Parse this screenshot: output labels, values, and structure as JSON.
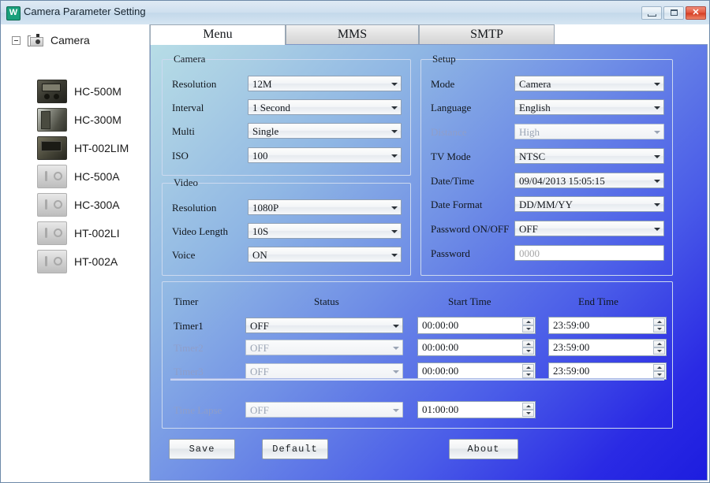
{
  "window": {
    "title": "Camera Parameter Setting",
    "icon": "app-icon",
    "minimize_label": "Minimize",
    "maximize_label": "Maximize",
    "close_label": "Close"
  },
  "sidebar": {
    "root": {
      "label": "Camera",
      "expander": "collapse-minus-icon",
      "icon": "camera-icon"
    },
    "items": [
      {
        "label": "HC-500M",
        "icon": "camera-thumb-icon"
      },
      {
        "label": "HC-300M",
        "icon": "camera-thumb-icon"
      },
      {
        "label": "HT-002LIM",
        "icon": "camera-thumb-icon"
      },
      {
        "label": "HC-500A",
        "icon": "camera-placeholder-icon"
      },
      {
        "label": "HC-300A",
        "icon": "camera-placeholder-icon"
      },
      {
        "label": "HT-002LI",
        "icon": "camera-placeholder-icon"
      },
      {
        "label": "HT-002A",
        "icon": "camera-placeholder-icon"
      }
    ]
  },
  "tabs": [
    {
      "label": "Menu",
      "active": true
    },
    {
      "label": "MMS",
      "active": false
    },
    {
      "label": "SMTP",
      "active": false
    }
  ],
  "camera_group": {
    "title": "Camera",
    "fields": [
      {
        "label": "Resolution",
        "value": "12M",
        "disabled": false
      },
      {
        "label": "Interval",
        "value": "1  Second",
        "disabled": false
      },
      {
        "label": "Multi",
        "value": "Single",
        "disabled": false
      },
      {
        "label": "ISO",
        "value": "100",
        "disabled": false
      }
    ]
  },
  "video_group": {
    "title": "Video",
    "fields": [
      {
        "label": "Resolution",
        "value": "1080P",
        "disabled": false
      },
      {
        "label": "Video Length",
        "value": "10S",
        "disabled": false
      },
      {
        "label": "Voice",
        "value": "ON",
        "disabled": false
      }
    ]
  },
  "setup_group": {
    "title": "Setup",
    "fields": [
      {
        "label": "Mode",
        "value": "Camera",
        "disabled": false,
        "type": "combo"
      },
      {
        "label": "Language",
        "value": "English",
        "disabled": false,
        "type": "combo"
      },
      {
        "label": "Distance",
        "value": "High",
        "disabled": true,
        "type": "combo"
      },
      {
        "label": "TV Mode",
        "value": "NTSC",
        "disabled": false,
        "type": "combo"
      },
      {
        "label": "Date/Time",
        "value": "09/04/2013 15:05:15",
        "disabled": false,
        "type": "combo"
      },
      {
        "label": "Date Format",
        "value": "DD/MM/YY",
        "disabled": false,
        "type": "combo"
      },
      {
        "label": "Password ON/OFF",
        "value": "OFF",
        "disabled": false,
        "type": "combo"
      },
      {
        "label": "Password",
        "value": "0000",
        "disabled": true,
        "type": "text"
      }
    ]
  },
  "timer_group": {
    "columns": {
      "timer": "Timer",
      "status": "Status",
      "start_time": "Start Time",
      "end_time": "End Time"
    },
    "rows": [
      {
        "label": "Timer1",
        "status": "OFF",
        "start_time": "00:00:00",
        "end_time": "23:59:00",
        "disabled": false
      },
      {
        "label": "Timer2",
        "status": "OFF",
        "start_time": "00:00:00",
        "end_time": "23:59:00",
        "disabled": true
      },
      {
        "label": "Timer3",
        "status": "OFF",
        "start_time": "00:00:00",
        "end_time": "23:59:00",
        "disabled": true
      }
    ],
    "time_lapse": {
      "label": "Time Lapse",
      "status": "OFF",
      "interval": "01:00:00",
      "disabled": true
    }
  },
  "buttons": {
    "save": "Save",
    "default": "Default",
    "about": "About"
  },
  "colors": {
    "panel_start": "#b7dde6",
    "panel_end": "#1d1ddf",
    "accent": "#2a2ae4",
    "titlebar": "#cfe0ef",
    "close_button": "#d33a20"
  }
}
